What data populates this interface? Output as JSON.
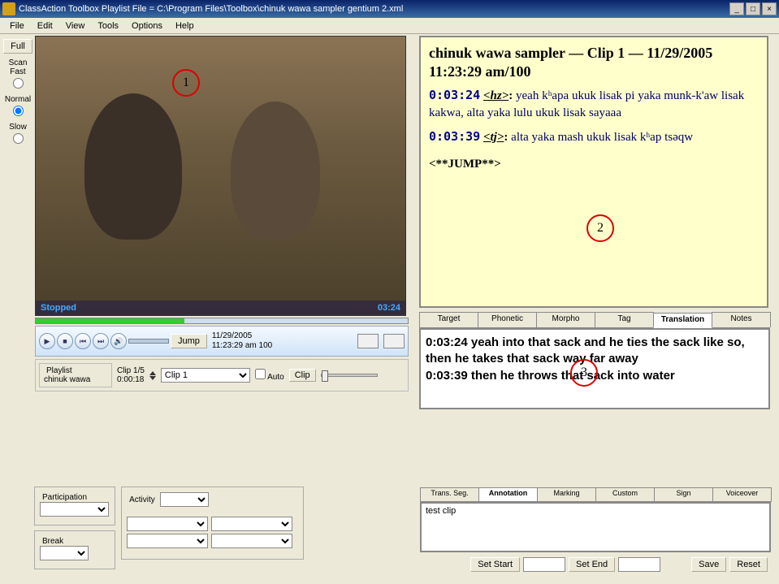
{
  "window": {
    "title": "ClassAction Toolbox    Playlist File = C:\\Program Files\\Toolbox\\chinuk wawa sampler gentium 2.xml"
  },
  "menu": [
    "File",
    "Edit",
    "View",
    "Tools",
    "Options",
    "Help"
  ],
  "leftctrl": {
    "full": "Full",
    "scanfast": "Scan\nFast",
    "normal": "Normal",
    "slow": "Slow"
  },
  "video": {
    "status": "Stopped",
    "time": "03:24"
  },
  "player": {
    "jump": "Jump",
    "date": "11/29/2005",
    "datetime": "11:23:29 am  100"
  },
  "playlist": {
    "legend": "Playlist",
    "name": "chinuk wawa",
    "clipcount": "Clip 1/5",
    "duration": "0:00:18",
    "clipselect": "Clip 1",
    "auto": "Auto",
    "clipbtn": "Clip"
  },
  "transcript": {
    "header": "chinuk wawa sampler — Clip 1 — 11/29/2005 11:23:29 am/100",
    "line1_time": "0:03:24",
    "line1_speaker": "<hz>",
    "line1_text": "yeah kʰapa ukuk lisak pi yaka munk-k'aw lisak kakwa,  alta yaka lulu ukuk lisak sayaaa",
    "line2_time": "0:03:39",
    "line2_speaker": "<tj>",
    "line2_text": "alta yaka mash ukuk lisak kʰap tsəqw",
    "jump": "<**JUMP**>"
  },
  "tabs": [
    "Target",
    "Phonetic",
    "Morpho",
    "Tag",
    "Translation",
    "Notes"
  ],
  "translation": {
    "line1": "0:03:24  yeah into that sack and he ties the sack like so,  then he takes that sack way far away",
    "line2": "0:03:39  then he throws that sack into water"
  },
  "lower": {
    "participation": "Participation",
    "break": "Break",
    "activity": "Activity"
  },
  "annotabs": [
    "Trans. Seg.",
    "Annotation",
    "Marking",
    "Custom",
    "Sign",
    "Voiceover"
  ],
  "annotext": "test clip",
  "annobtns": {
    "setstart": "Set Start",
    "setend": "Set End",
    "save": "Save",
    "reset": "Reset"
  },
  "annotations": {
    "c1": "1",
    "c2": "2",
    "c3": "3"
  }
}
